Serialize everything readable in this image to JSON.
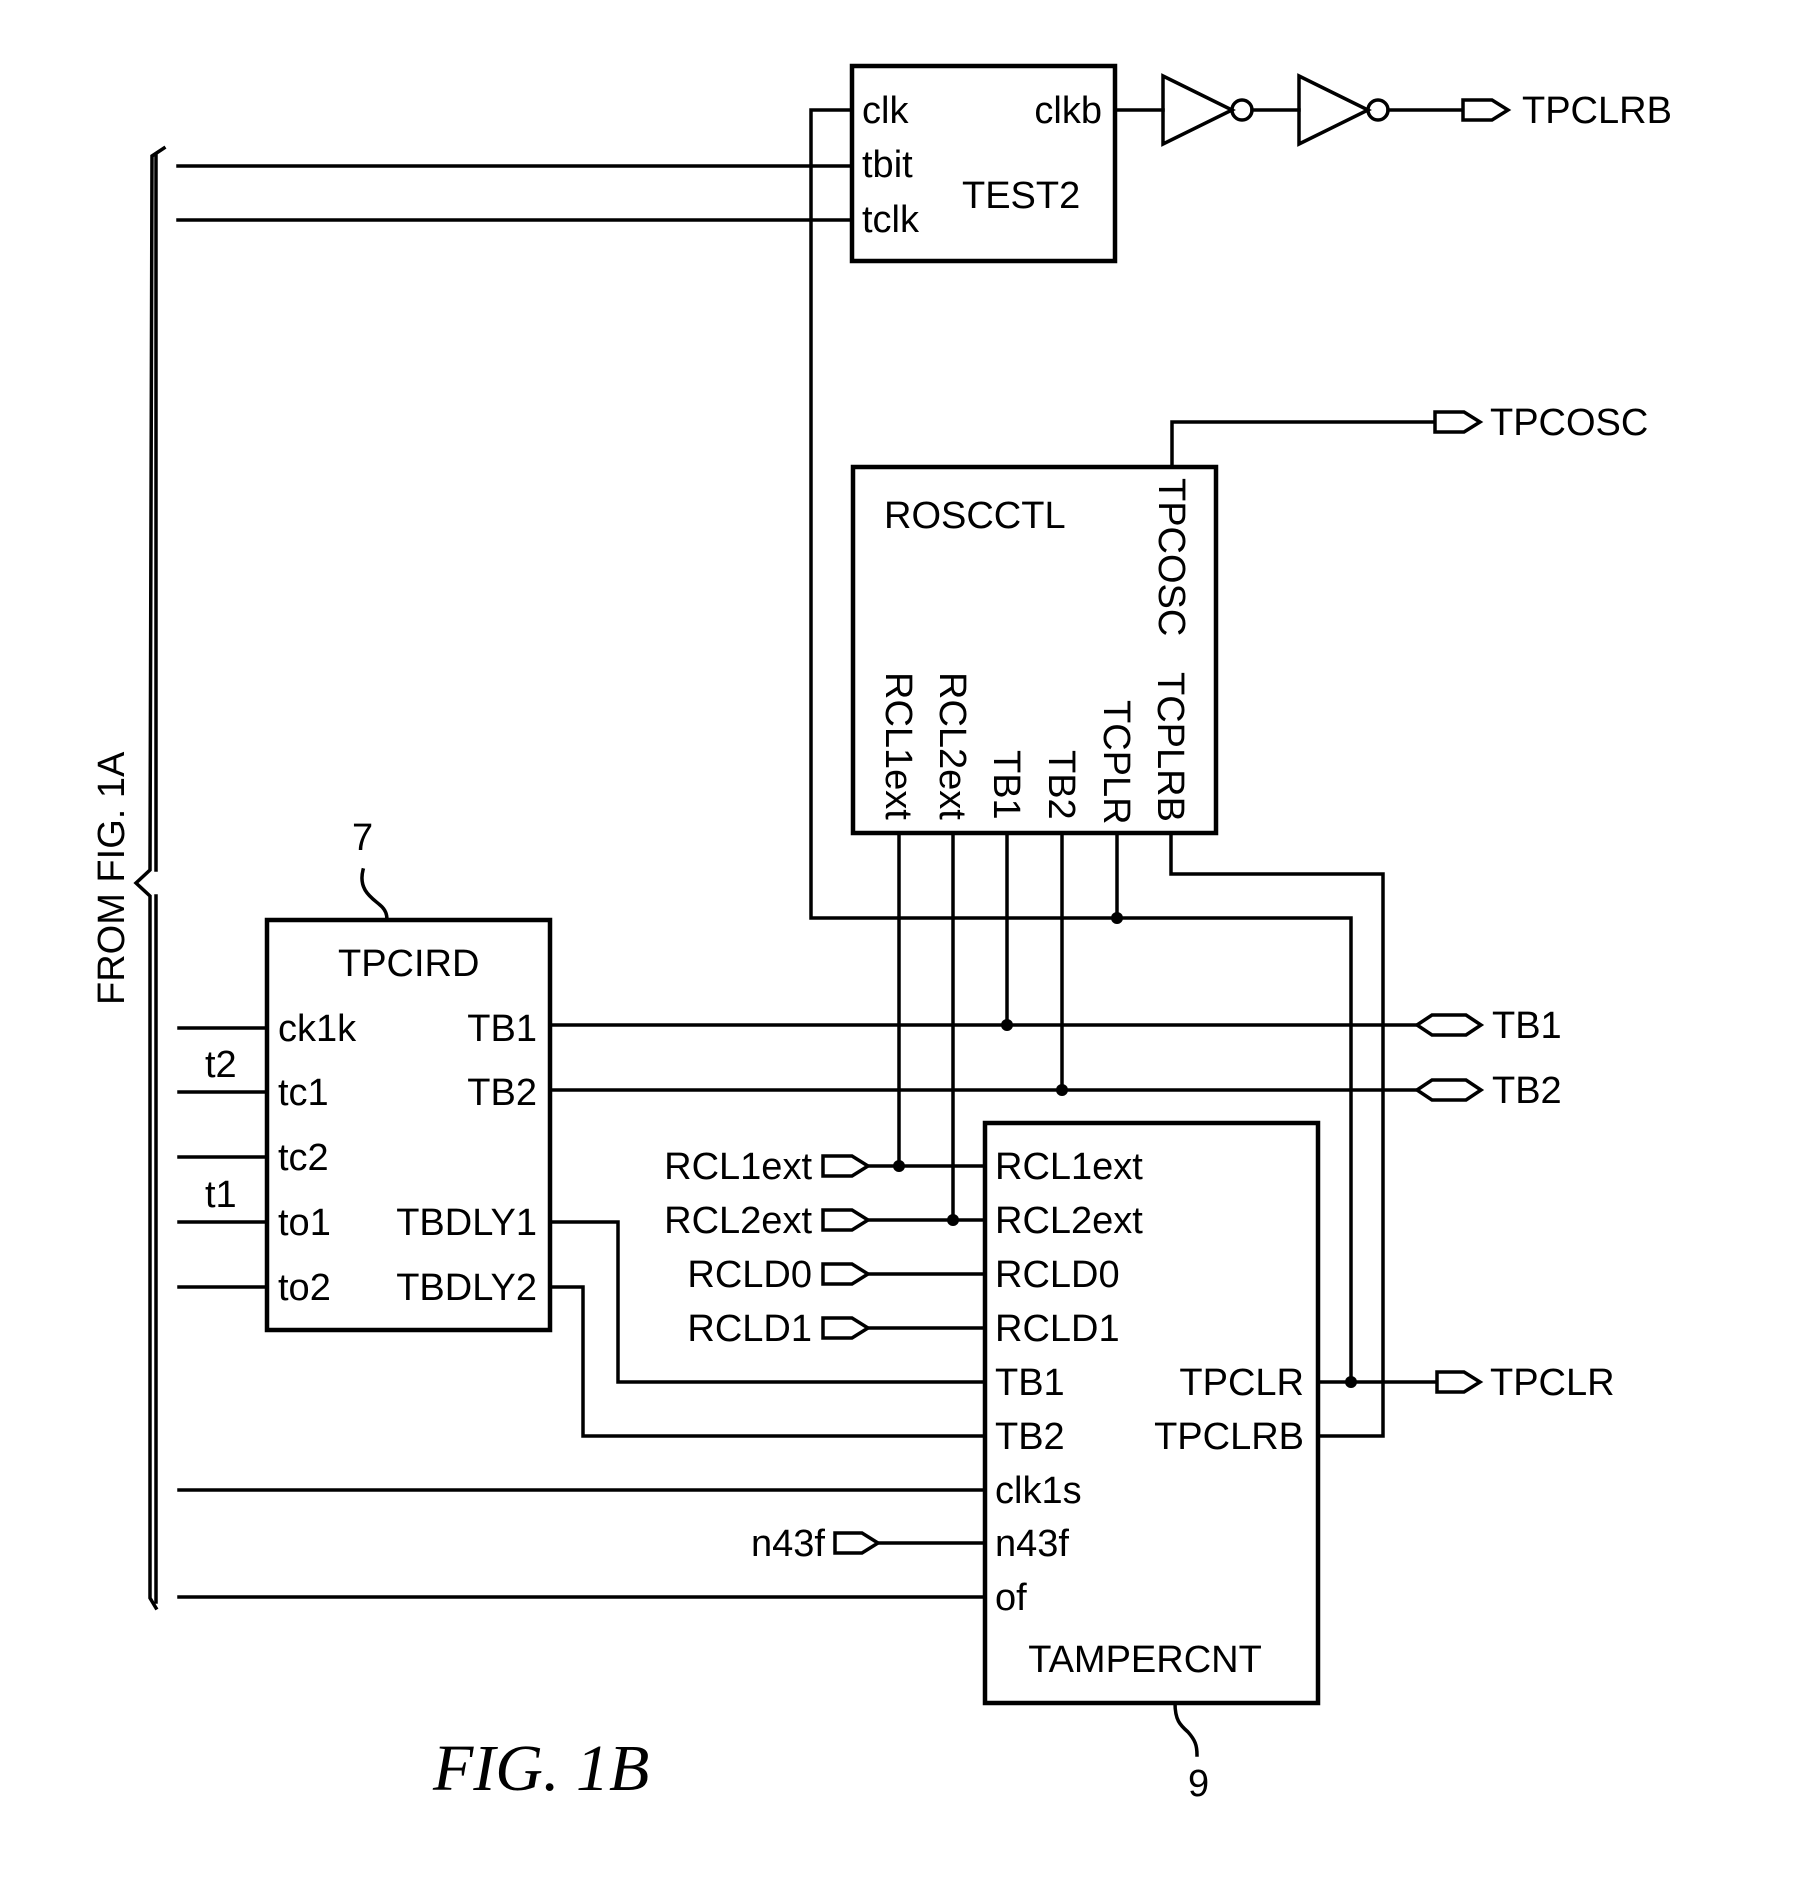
{
  "figure": {
    "caption": "FIG. 1B",
    "from_label": "FROM FIG. 1A"
  },
  "blocks": {
    "test2": {
      "name": "TEST2",
      "inputs": [
        "clk",
        "tbit",
        "tclk"
      ],
      "output": "clkb"
    },
    "roscctl": {
      "name": "ROSCCTL",
      "top_pin": "TPCOSC",
      "bottom_pins": [
        "RCL1ext",
        "RCL2ext",
        "TB1",
        "TB2",
        "TCPLR",
        "TCPLRB"
      ]
    },
    "tpcird": {
      "name": "TPCIRD",
      "ref": "7",
      "inputs": [
        "ck1k",
        "tc1",
        "tc2",
        "to1",
        "to2"
      ],
      "outputs": [
        "TB1",
        "TB2",
        "TBDLY1",
        "TBDLY2"
      ],
      "net_labels": [
        "t2",
        "t1"
      ]
    },
    "tampercnt": {
      "name": "TAMPERCNT",
      "ref": "9",
      "inputs": [
        "RCL1ext",
        "RCL2ext",
        "RCLD0",
        "RCLD1",
        "TB1",
        "TB2",
        "clk1s",
        "n43f",
        "of"
      ],
      "outputs": [
        "TPCLR",
        "TPCLRB"
      ]
    }
  },
  "ports": {
    "outputs": [
      "TPCLRB",
      "TPCOSC",
      "TPCLR"
    ],
    "bidirectional": [
      "TB1",
      "TB2"
    ],
    "inputs": [
      "RCL1ext",
      "RCL2ext",
      "RCLD0",
      "RCLD1",
      "n43f"
    ]
  }
}
